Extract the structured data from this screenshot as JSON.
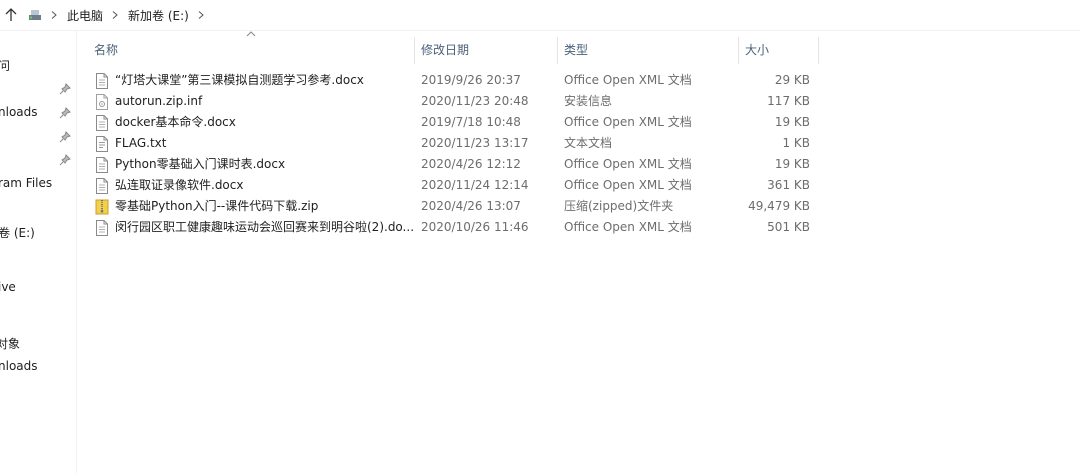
{
  "breadcrumb": [
    "此电脑",
    "新加卷 (E:)"
  ],
  "nav_items": [
    {
      "label": "问",
      "pinned": false
    },
    {
      "label": "nloads",
      "pinned": true
    },
    {
      "label": "",
      "pinned": true
    },
    {
      "label": "",
      "pinned": true
    },
    {
      "label": "ram Files",
      "pinned": false
    },
    {
      "label": "卷 (E:)",
      "pinned": false
    },
    {
      "label": "ive",
      "pinned": false
    },
    {
      "label": "对象",
      "pinned": false
    },
    {
      "label": "nloads",
      "pinned": false
    }
  ],
  "columns": {
    "name": "名称",
    "date": "修改日期",
    "type": "类型",
    "size": "大小"
  },
  "files": [
    {
      "name": "“灯塔大课堂”第三课模拟自测题学习参考.docx",
      "date": "2019/9/26 20:37",
      "type": "Office Open XML 文档",
      "size": "29 KB",
      "icon": "document-icon"
    },
    {
      "name": "autorun.zip.inf",
      "date": "2020/11/23 20:48",
      "type": "安装信息",
      "size": "117 KB",
      "icon": "setup-info-icon"
    },
    {
      "name": "docker基本命令.docx",
      "date": "2019/7/18 10:48",
      "type": "Office Open XML 文档",
      "size": "19 KB",
      "icon": "document-icon"
    },
    {
      "name": "FLAG.txt",
      "date": "2020/11/23 13:17",
      "type": "文本文档",
      "size": "1 KB",
      "icon": "text-file-icon"
    },
    {
      "name": "Python零基础入门课时表.docx",
      "date": "2020/4/26 12:12",
      "type": "Office Open XML 文档",
      "size": "19 KB",
      "icon": "document-icon"
    },
    {
      "name": "弘连取证录像软件.docx",
      "date": "2020/11/24 12:14",
      "type": "Office Open XML 文档",
      "size": "361 KB",
      "icon": "document-icon"
    },
    {
      "name": "零基础Python入门--课件代码下载.zip",
      "date": "2020/4/26 13:07",
      "type": "压缩(zipped)文件夹",
      "size": "49,479 KB",
      "icon": "zip-folder-icon"
    },
    {
      "name": "闵行园区职工健康趣味运动会巡回赛来到明谷啦(2).do...",
      "date": "2020/10/26 11:46",
      "type": "Office Open XML 文档",
      "size": "501 KB",
      "icon": "document-icon"
    }
  ]
}
